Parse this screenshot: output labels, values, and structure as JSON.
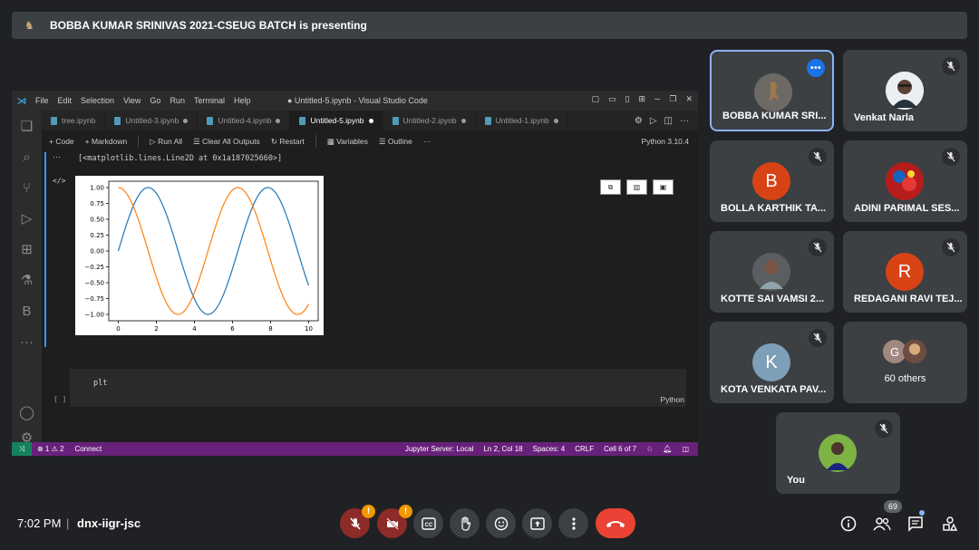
{
  "banner": {
    "text": "BOBBA KUMAR SRINIVAS 2021-CSEUG BATCH is presenting"
  },
  "vscode": {
    "menu": [
      "File",
      "Edit",
      "Selection",
      "View",
      "Go",
      "Run",
      "Terminal",
      "Help"
    ],
    "window_title": "● Untitled-5.ipynb - Visual Studio Code",
    "tabs": [
      {
        "label": "tree.ipynb"
      },
      {
        "label": "Untitled-3.ipynb"
      },
      {
        "label": "Untitled-4.ipynb"
      },
      {
        "label": "Untitled-5.ipynb",
        "active": true
      },
      {
        "label": "Untitled-2.ipynb"
      },
      {
        "label": "Untitled-1.ipynb"
      }
    ],
    "toolbar": {
      "code": "+ Code",
      "markdown": "+ Markdown",
      "run_all": "▷ Run All",
      "clear_outputs": "☰ Clear All Outputs",
      "restart": "↻ Restart",
      "variables": "▦ Variables",
      "outline": "☰ Outline",
      "more": "···",
      "kernel": "Python 3.10.4"
    },
    "output_text": "[<matplotlib.lines.Line2D at 0x1a187025660>]",
    "cell2": {
      "code": "plt",
      "lang": "Python",
      "exec": "[ ]"
    },
    "status_left": [
      "⊗ 1 ⚠ 2",
      "Connect"
    ],
    "status_right": [
      "Jupyter Server: Local",
      "Ln 2, Col 18",
      "Spaces: 4",
      "CRLF",
      "Cell 6 of 7"
    ]
  },
  "chart_data": {
    "type": "line",
    "xlim": [
      0,
      10
    ],
    "ylim": [
      -1.0,
      1.0
    ],
    "x_ticks": [
      "0",
      "2",
      "4",
      "6",
      "8",
      "10"
    ],
    "y_ticks": [
      "1.00",
      "0.75",
      "0.50",
      "0.25",
      "0.00",
      "−0.25",
      "−0.50",
      "−0.75",
      "−1.00"
    ],
    "series": [
      {
        "function": "sin",
        "color": "#1f77b4"
      },
      {
        "function": "cos",
        "color": "#ff7f0e"
      }
    ],
    "grid": false
  },
  "participants": [
    {
      "name": "BOBBA KUMAR SRI...",
      "avatar_type": "photo",
      "selected": true
    },
    {
      "name": "Venkat Narla",
      "avatar_type": "photo"
    },
    {
      "name": "BOLLA KARTHIK TA...",
      "initial": "B",
      "color": "#d84315"
    },
    {
      "name": "ADINI PARIMAL SES...",
      "avatar_type": "photo"
    },
    {
      "name": "KOTTE SAI VAMSI 2...",
      "avatar_type": "photo"
    },
    {
      "name": "REDAGANI RAVI TEJ...",
      "initial": "R",
      "color": "#d84315"
    },
    {
      "name": "KOTA VENKATA PAV...",
      "initial": "K",
      "color": "#7e9fb8"
    }
  ],
  "others": {
    "label": "60 others",
    "initial": "G"
  },
  "you": {
    "name": "You"
  },
  "bottom": {
    "time": "7:02 PM",
    "separator": "|",
    "meeting_code": "dnx-iigr-jsc",
    "people_count": "69"
  },
  "colors": {
    "accent": "#8ab4f8",
    "hangup": "#ea4335",
    "warning": "#f29900"
  }
}
